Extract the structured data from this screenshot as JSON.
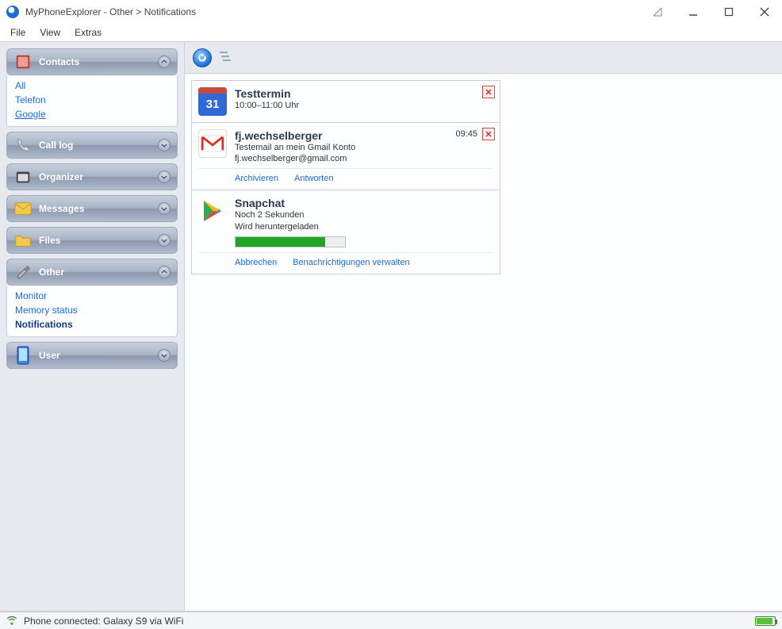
{
  "window": {
    "title": "MyPhoneExplorer -  Other > Notifications"
  },
  "menu": {
    "file": "File",
    "view": "View",
    "extras": "Extras"
  },
  "sidebar": {
    "contacts": {
      "label": "Contacts",
      "items": [
        "All",
        "Telefon",
        "Google"
      ]
    },
    "calllog": "Call log",
    "organizer": "Organizer",
    "messages": "Messages",
    "files": "Files",
    "other": {
      "label": "Other",
      "items": [
        "Monitor",
        "Memory status",
        "Notifications"
      ]
    },
    "user": "User"
  },
  "notifications": [
    {
      "app": "calendar",
      "icon_day": "31",
      "title": "Testtermin",
      "line1": "10:00–11:00 Uhr",
      "time": "",
      "actions": []
    },
    {
      "app": "gmail",
      "title": "fj.wechselberger",
      "line1": "Testemail an mein Gmail Konto",
      "line2": "fj.wechselberger@gmail.com",
      "time": "09:45",
      "actions": [
        "Archivieren",
        "Antworten"
      ]
    },
    {
      "app": "play",
      "title": "Snapchat",
      "line1": "Noch 2 Sekunden",
      "line2": "Wird heruntergeladen",
      "progress_pct": 82,
      "actions": [
        "Abbrechen",
        "Benachrichtigungen verwalten"
      ]
    }
  ],
  "status": {
    "text": "Phone connected: Galaxy S9 via WiFi"
  }
}
